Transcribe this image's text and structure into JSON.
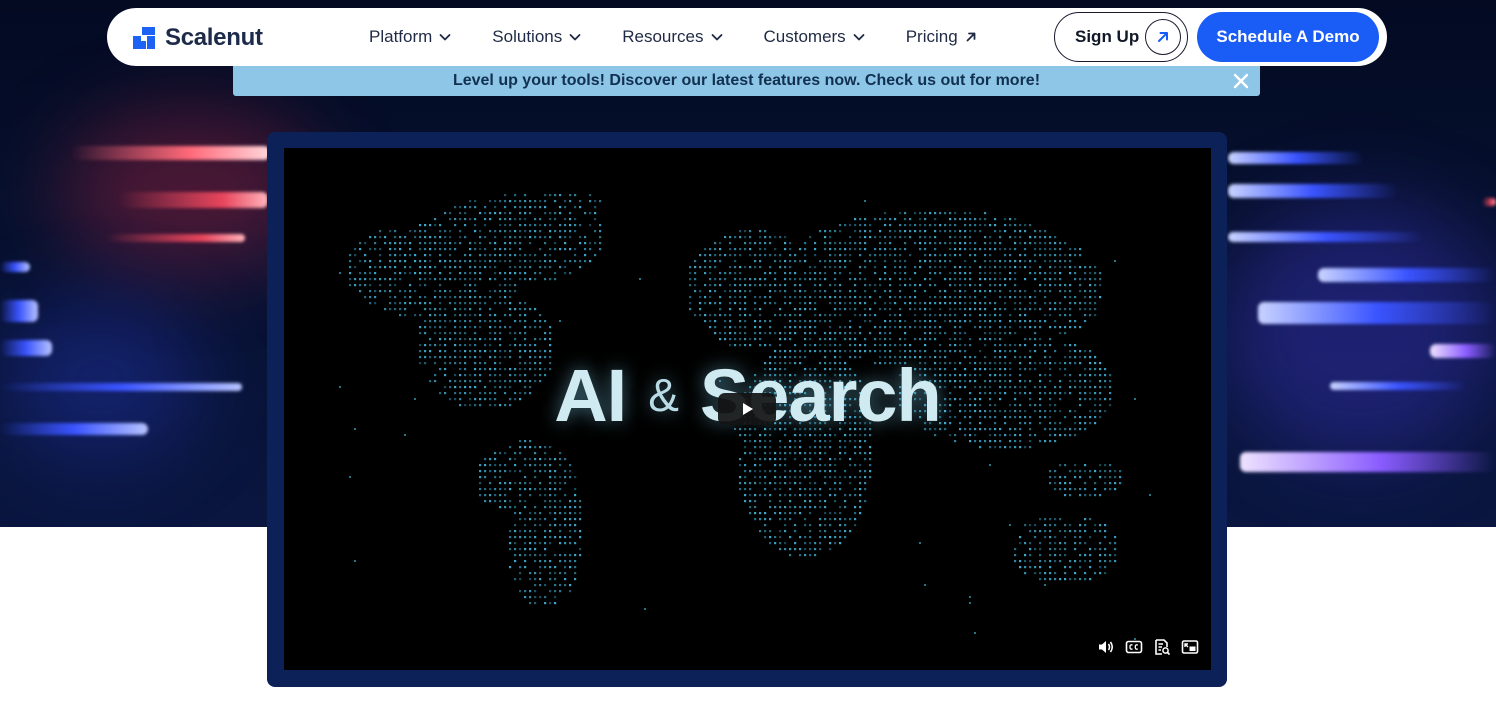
{
  "brand": {
    "name": "Scalenut",
    "accent": "#1a5cf6"
  },
  "nav": {
    "items": [
      {
        "label": "Platform",
        "icon": "chevron-down-icon"
      },
      {
        "label": "Solutions",
        "icon": "chevron-down-icon"
      },
      {
        "label": "Resources",
        "icon": "chevron-down-icon"
      },
      {
        "label": "Customers",
        "icon": "chevron-down-icon"
      },
      {
        "label": "Pricing",
        "icon": "arrow-up-right-icon"
      }
    ],
    "signup_label": "Sign Up",
    "demo_label": "Schedule A Demo"
  },
  "announcement": {
    "text": "Level up your tools! Discover our latest features now. Check us out for more!",
    "background": "#8ec6e8"
  },
  "video": {
    "title_left": "AI",
    "title_amp": "&",
    "title_right": "Search",
    "controls": [
      "volume-icon",
      "captions-icon",
      "transcript-icon",
      "picture-in-picture-icon"
    ]
  }
}
